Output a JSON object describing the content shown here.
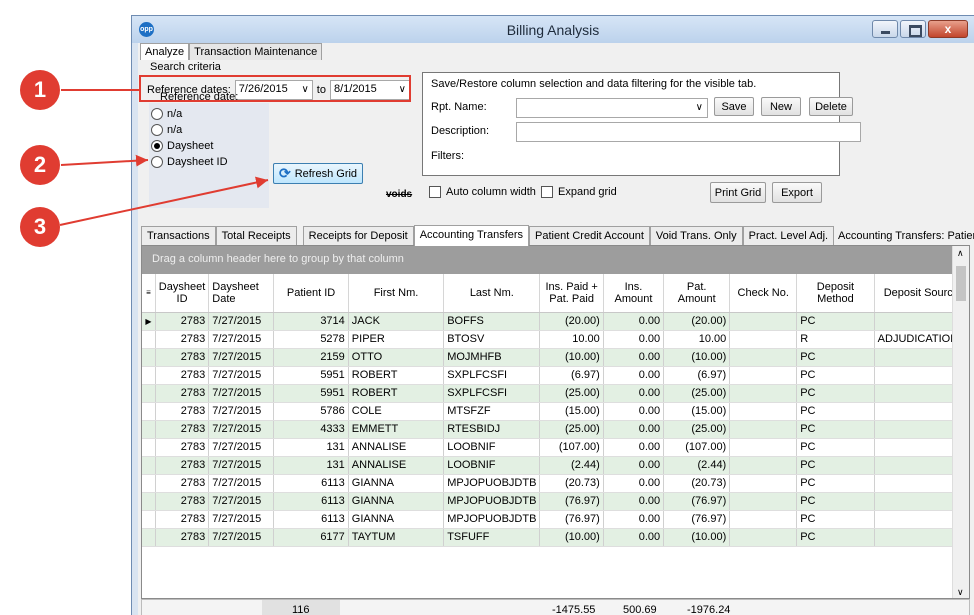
{
  "window": {
    "title": "Billing Analysis",
    "icon_label": "opp",
    "close_glyph": "x"
  },
  "top_tabs": [
    {
      "label": "Analyze"
    },
    {
      "label": "Transaction Maintenance"
    }
  ],
  "search": {
    "section_label": "Search criteria",
    "ref_dates_label": "Reference dates:",
    "date_from": "7/26/2015",
    "to_label": "to",
    "date_to": "8/1/2015",
    "ref_date_title": "Reference date:",
    "radios": [
      {
        "label": "n/a",
        "checked": false
      },
      {
        "label": "n/a",
        "checked": false
      },
      {
        "label": "Daysheet",
        "checked": true
      },
      {
        "label": "Daysheet ID",
        "checked": false
      }
    ],
    "refresh_label": "Refresh Grid",
    "voids_label": "voids"
  },
  "save_restore": {
    "title": "Save/Restore column selection and data filtering for the visible tab.",
    "rpt_name_label": "Rpt. Name:",
    "rpt_name_value": "",
    "save_label": "Save",
    "new_label": "New",
    "delete_label": "Delete",
    "description_label": "Description:",
    "filters_label": "Filters:"
  },
  "options": {
    "auto_col_width": "Auto column width",
    "expand_grid": "Expand grid",
    "print_grid": "Print Grid",
    "export": "Export"
  },
  "grid_tabs": [
    {
      "label": "Transactions"
    },
    {
      "label": "Total Receipts"
    },
    {
      "label": "Receipts for Deposit"
    },
    {
      "label": "Accounting Transfers",
      "active": true
    },
    {
      "label": "Patient Credit Account"
    },
    {
      "label": "Void Trans. Only"
    },
    {
      "label": "Pract. Level Adj."
    }
  ],
  "grid_caption": "Accounting Transfers: Patient",
  "grid": {
    "group_hint": "Drag a column header here to group by that column",
    "columns": [
      "Daysheet ID",
      "Daysheet Date",
      "Patient ID",
      "First Nm.",
      "Last Nm.",
      "Ins. Paid + Pat. Paid",
      "Ins. Amount",
      "Pat. Amount",
      "Check No.",
      "Deposit Method",
      "Deposit Source"
    ],
    "rows": [
      [
        "2783",
        "7/27/2015",
        "3714",
        "JACK",
        "BOFFS",
        "(20.00)",
        "0.00",
        "(20.00)",
        "",
        "PC",
        ""
      ],
      [
        "2783",
        "7/27/2015",
        "5278",
        "PIPER",
        "BTOSV",
        "10.00",
        "0.00",
        "10.00",
        "",
        "R",
        "ADJUDICATION"
      ],
      [
        "2783",
        "7/27/2015",
        "2159",
        "OTTO",
        "MOJMHFB",
        "(10.00)",
        "0.00",
        "(10.00)",
        "",
        "PC",
        ""
      ],
      [
        "2783",
        "7/27/2015",
        "5951",
        "ROBERT",
        "SXPLFCSFI",
        "(6.97)",
        "0.00",
        "(6.97)",
        "",
        "PC",
        ""
      ],
      [
        "2783",
        "7/27/2015",
        "5951",
        "ROBERT",
        "SXPLFCSFI",
        "(25.00)",
        "0.00",
        "(25.00)",
        "",
        "PC",
        ""
      ],
      [
        "2783",
        "7/27/2015",
        "5786",
        "COLE",
        "MTSFZF",
        "(15.00)",
        "0.00",
        "(15.00)",
        "",
        "PC",
        ""
      ],
      [
        "2783",
        "7/27/2015",
        "4333",
        "EMMETT",
        "RTESBIDJ",
        "(25.00)",
        "0.00",
        "(25.00)",
        "",
        "PC",
        ""
      ],
      [
        "2783",
        "7/27/2015",
        "131",
        "ANNALISE",
        "LOOBNIF",
        "(107.00)",
        "0.00",
        "(107.00)",
        "",
        "PC",
        ""
      ],
      [
        "2783",
        "7/27/2015",
        "131",
        "ANNALISE",
        "LOOBNIF",
        "(2.44)",
        "0.00",
        "(2.44)",
        "",
        "PC",
        ""
      ],
      [
        "2783",
        "7/27/2015",
        "6113",
        "GIANNA",
        "MPJOPUOBJDTB",
        "(20.73)",
        "0.00",
        "(20.73)",
        "",
        "PC",
        ""
      ],
      [
        "2783",
        "7/27/2015",
        "6113",
        "GIANNA",
        "MPJOPUOBJDTB",
        "(76.97)",
        "0.00",
        "(76.97)",
        "",
        "PC",
        ""
      ],
      [
        "2783",
        "7/27/2015",
        "6113",
        "GIANNA",
        "MPJOPUOBJDTB",
        "(76.97)",
        "0.00",
        "(76.97)",
        "",
        "PC",
        ""
      ],
      [
        "2783",
        "7/27/2015",
        "6177",
        "TAYTUM",
        "TSFUFF",
        "(10.00)",
        "0.00",
        "(10.00)",
        "",
        "PC",
        ""
      ]
    ],
    "totals": {
      "patient_count": "116",
      "ins_paid_pat_paid": "-1475.55",
      "ins_amount": "500.69",
      "pat_amount": "-1976.24"
    }
  },
  "callouts": [
    "1",
    "2",
    "3"
  ],
  "colors": {
    "callout": "#e03c31",
    "alt_row": "#e3f0e3",
    "group_bar": "#9d9d9d"
  }
}
